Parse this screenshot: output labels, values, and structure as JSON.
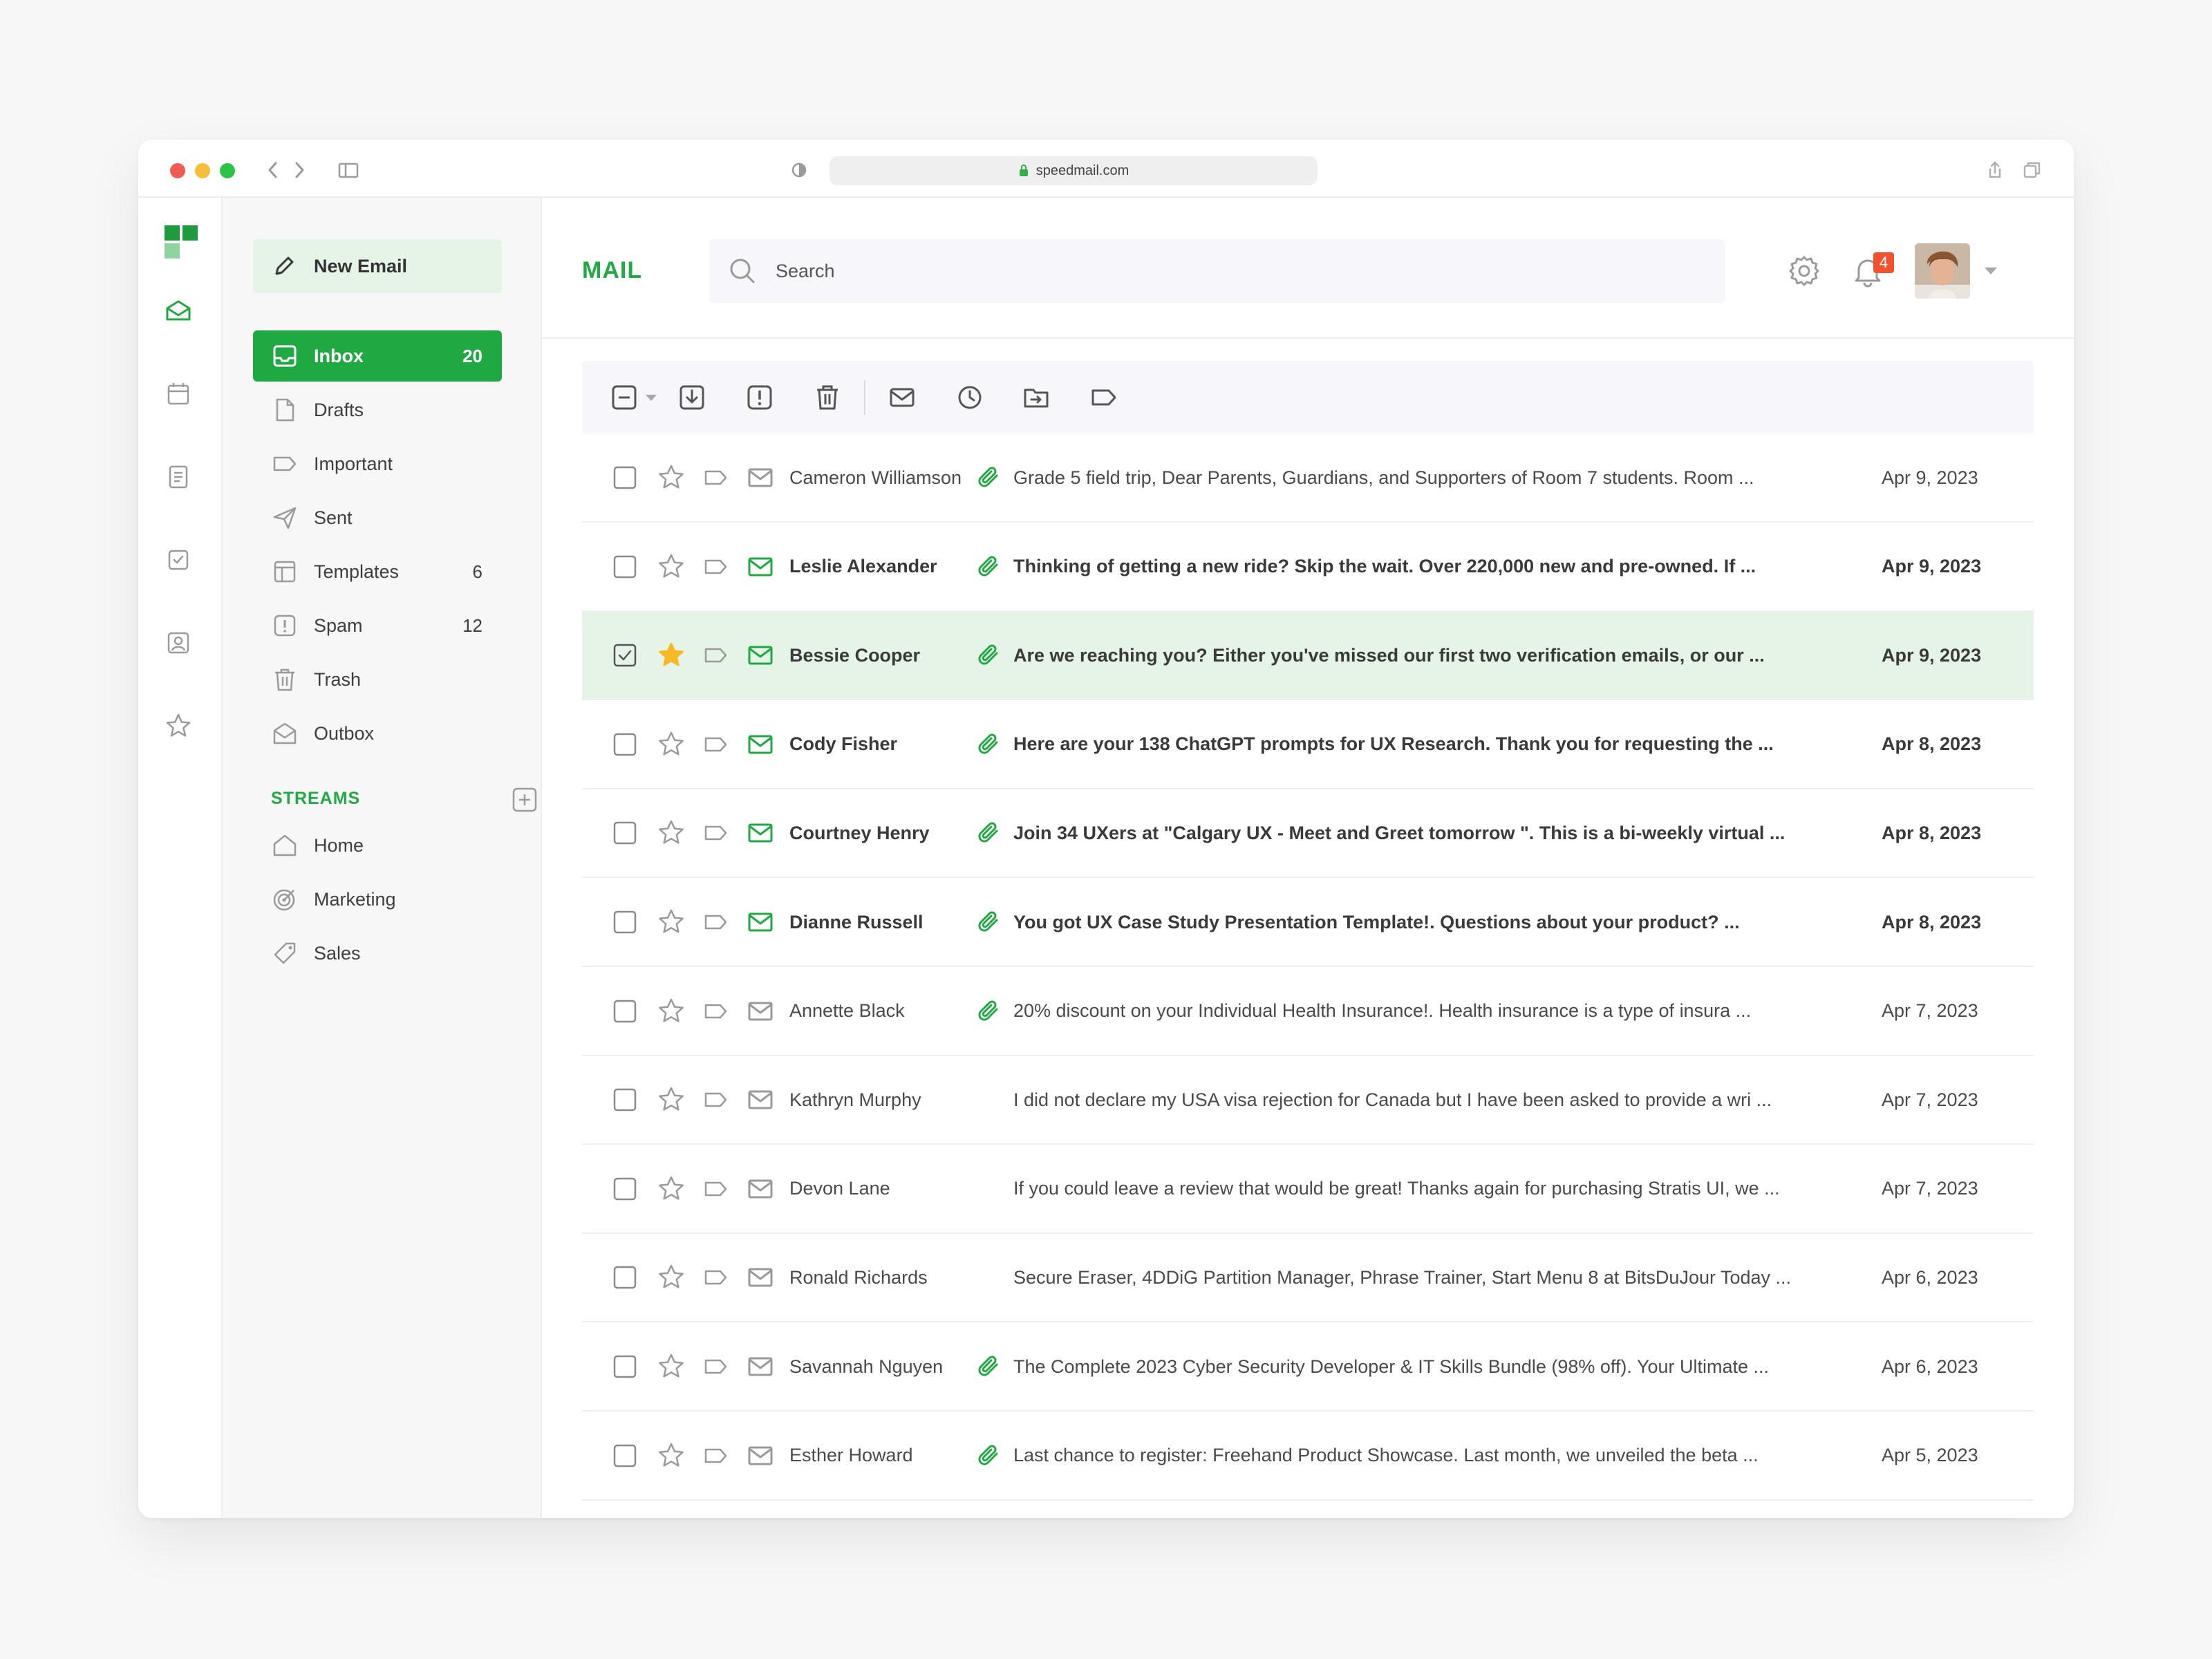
{
  "browser": {
    "url": "speedmail.com"
  },
  "sidebar": {
    "new_email_label": "New Email",
    "items": [
      {
        "label": "Inbox",
        "count": "20",
        "icon": "inbox-icon",
        "active": true
      },
      {
        "label": "Drafts",
        "count": "",
        "icon": "draft-icon"
      },
      {
        "label": "Important",
        "count": "",
        "icon": "label-icon"
      },
      {
        "label": "Sent",
        "count": "",
        "icon": "send-icon"
      },
      {
        "label": "Templates",
        "count": "6",
        "icon": "template-icon"
      },
      {
        "label": "Spam",
        "count": "12",
        "icon": "spam-icon"
      },
      {
        "label": "Trash",
        "count": "",
        "icon": "trash-icon"
      },
      {
        "label": "Outbox",
        "count": "",
        "icon": "outbox-icon"
      }
    ],
    "streams_title": "STREAMS",
    "streams": [
      {
        "label": "Home",
        "icon": "home-icon"
      },
      {
        "label": "Marketing",
        "icon": "target-icon"
      },
      {
        "label": "Sales",
        "icon": "price-tag-icon"
      }
    ]
  },
  "header": {
    "title": "MAIL",
    "search_placeholder": "Search",
    "notification_count": "4"
  },
  "colors": {
    "accent": "#20a842",
    "selected_row": "#e5f4e7",
    "badge": "#f2522e",
    "star_active": "#f7b928"
  },
  "emails": [
    {
      "sender": "Cameron Williamson",
      "subject": "Grade 5 field trip, Dear Parents, Guardians, and Supporters of Room 7 students. Room ...",
      "date": "Apr 9, 2023",
      "unread": false,
      "attachment": true,
      "selected": false,
      "starred": false
    },
    {
      "sender": "Leslie Alexander",
      "subject": "Thinking of getting a new ride? Skip the wait. Over 220,000 new and pre-owned. If  ...",
      "date": "Apr 9, 2023",
      "unread": true,
      "attachment": true,
      "selected": false,
      "starred": false
    },
    {
      "sender": "Bessie Cooper",
      "subject": "Are we reaching you? Either you've missed our first two verification emails, or our ...",
      "date": "Apr 9, 2023",
      "unread": true,
      "attachment": true,
      "selected": true,
      "starred": true
    },
    {
      "sender": "Cody Fisher",
      "subject": "Here are your 138 ChatGPT prompts for UX Research. Thank you for requesting the ...",
      "date": "Apr 8, 2023",
      "unread": true,
      "attachment": true,
      "selected": false,
      "starred": false
    },
    {
      "sender": "Courtney Henry",
      "subject": "Join 34 UXers at \"Calgary UX - Meet and Greet tomorrow \".  This is a bi-weekly virtual ...",
      "date": "Apr 8, 2023",
      "unread": true,
      "attachment": true,
      "selected": false,
      "starred": false
    },
    {
      "sender": "Dianne Russell",
      "subject": "You got UX Case Study Presentation Template!. Questions about your product?  ...",
      "date": "Apr 8, 2023",
      "unread": true,
      "attachment": true,
      "selected": false,
      "starred": false
    },
    {
      "sender": "Annette Black",
      "subject": "20% discount on your Individual Health Insurance!. Health insurance is a type of insura ...",
      "date": "Apr 7, 2023",
      "unread": false,
      "attachment": true,
      "selected": false,
      "starred": false
    },
    {
      "sender": "Kathryn Murphy",
      "subject": "I did not declare my USA visa rejection for Canada but I have been asked to provide a wri ...",
      "date": "Apr 7, 2023",
      "unread": false,
      "attachment": false,
      "selected": false,
      "starred": false
    },
    {
      "sender": "Devon Lane",
      "subject": "If you could leave a review that would be great! Thanks again for purchasing Stratis UI, we ...",
      "date": "Apr 7, 2023",
      "unread": false,
      "attachment": false,
      "selected": false,
      "starred": false
    },
    {
      "sender": "Ronald Richards",
      "subject": "Secure Eraser, 4DDiG Partition Manager, Phrase Trainer, Start Menu 8 at BitsDuJour Today ...",
      "date": "Apr 6, 2023",
      "unread": false,
      "attachment": false,
      "selected": false,
      "starred": false
    },
    {
      "sender": "Savannah Nguyen",
      "subject": "The Complete 2023 Cyber Security Developer & IT Skills Bundle (98% off). Your Ultimate ...",
      "date": "Apr 6, 2023",
      "unread": false,
      "attachment": true,
      "selected": false,
      "starred": false
    },
    {
      "sender": "Esther Howard",
      "subject": "Last chance to register: Freehand Product Showcase. Last month, we unveiled the beta ...",
      "date": "Apr 5, 2023",
      "unread": false,
      "attachment": true,
      "selected": false,
      "starred": false
    }
  ]
}
